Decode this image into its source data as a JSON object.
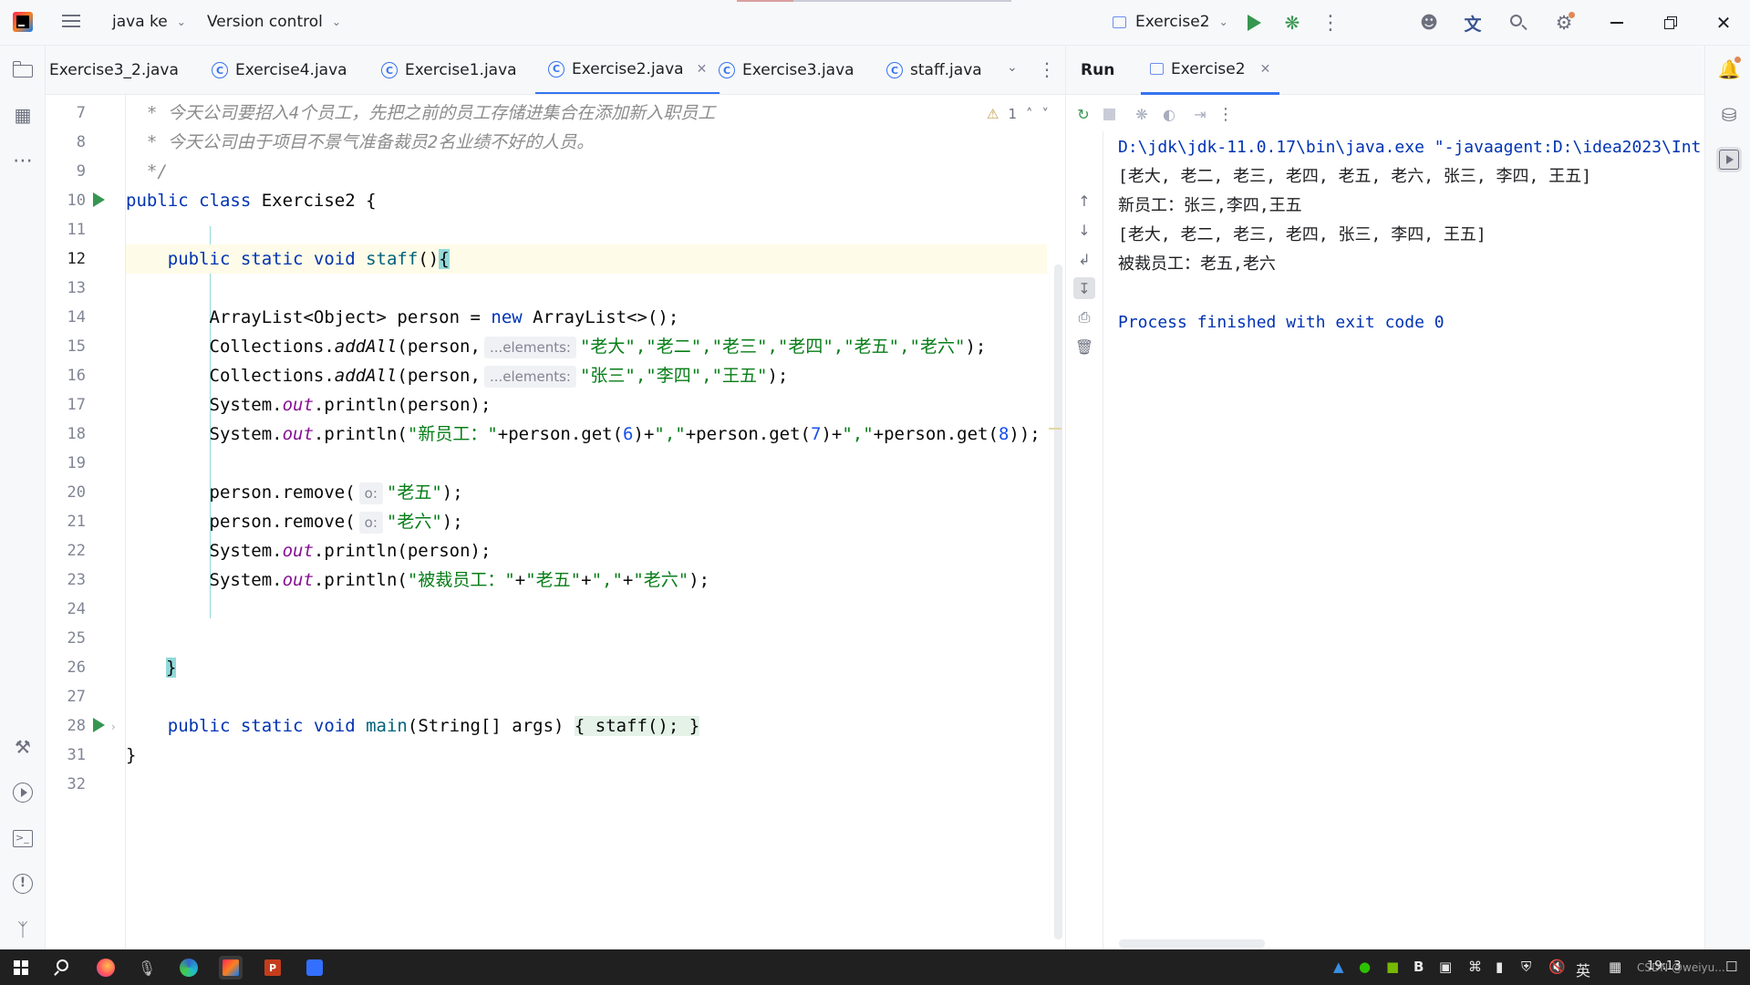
{
  "titlebar": {
    "project_label": "java ke",
    "vcs_label": "Version control",
    "run_config_label": "Exercise2"
  },
  "editor_tabs": [
    {
      "label": "Exercise3_2.java",
      "active": false
    },
    {
      "label": "Exercise4.java",
      "active": false
    },
    {
      "label": "Exercise1.java",
      "active": false
    },
    {
      "label": "Exercise2.java",
      "active": true
    },
    {
      "label": "Exercise3.java",
      "active": false
    },
    {
      "label": "staff.java",
      "active": false
    }
  ],
  "editor": {
    "warning_count": "1",
    "line_numbers": [
      "7",
      "8",
      "9",
      "10",
      "11",
      "12",
      "13",
      "14",
      "15",
      "16",
      "17",
      "18",
      "19",
      "20",
      "21",
      "22",
      "23",
      "24",
      "25",
      "26",
      "27",
      "28",
      "31",
      "32"
    ],
    "inlay_elements": "...elements:",
    "inlay_o": "o:",
    "lines": {
      "l7": "  * 今天公司要招入4个员工，先把之前的员工存储进集合在添加新入职员工",
      "l8": "  * 今天公司由于项目不景气准备裁员2名业绩不好的人员。",
      "l9": "  */",
      "l10_kw": "public class ",
      "l10_rest": "Exercise2 {",
      "l12_kw": "    public static void ",
      "l12_fn": "staff",
      "l12_paren": "()",
      "l12_brace": "{",
      "l14_a": "        ArrayList<Object> person = ",
      "l14_kw": "new",
      "l14_b": " ArrayList<>();",
      "l15_a": "        Collections.",
      "l15_m": "addAll",
      "l15_b": "(person,",
      "l15_str": "\"老大\",\"老二\",\"老三\",\"老四\",\"老五\",\"老六\"",
      "l15_end": ");",
      "l16_a": "        Collections.",
      "l16_m": "addAll",
      "l16_b": "(person,",
      "l16_str": "\"张三\",\"李四\",\"王五\"",
      "l16_end": ");",
      "l17_a": "        System.",
      "l17_f": "out",
      "l17_b": ".println(person);",
      "l18_a": "        System.",
      "l18_f": "out",
      "l18_b": ".println(",
      "l18_s1": "\"新员工：\"",
      "l18_c1": "+person.get(",
      "l18_n1": "6",
      "l18_c2": ")+",
      "l18_s2": "\",\"",
      "l18_c3": "+person.get(",
      "l18_n2": "7",
      "l18_c4": ")+",
      "l18_s3": "\",\"",
      "l18_c5": "+person.get(",
      "l18_n3": "8",
      "l18_c6": "));",
      "l20_a": "        person.remove(",
      "l20_str": "\"老五\"",
      "l20_end": ");",
      "l21_a": "        person.remove(",
      "l21_str": "\"老六\"",
      "l21_end": ");",
      "l22_a": "        System.",
      "l22_f": "out",
      "l22_b": ".println(person);",
      "l23_a": "        System.",
      "l23_f": "out",
      "l23_b": ".println(",
      "l23_s1": "\"被裁员工：\"",
      "l23_c1": "+",
      "l23_s2": "\"老五\"",
      "l23_c2": "+",
      "l23_s3": "\",\"",
      "l23_c3": "+",
      "l23_s4": "\"老六\"",
      "l23_end": ");",
      "l26": "}",
      "l28_kw": "    public static void ",
      "l28_fn": "main",
      "l28_b": "(String[] args) ",
      "l28_fold": "{ staff(); }",
      "l31": "}"
    }
  },
  "run_panel": {
    "title": "Run",
    "tab_label": "Exercise2",
    "console": [
      "D:\\jdk\\jdk-11.0.17\\bin\\java.exe \"-javaagent:D:\\idea2023\\Int",
      "[老大, 老二, 老三, 老四, 老五, 老六, 张三, 李四, 王五]",
      "新员工：张三,李四,王五",
      "[老大, 老二, 老三, 老四, 张三, 李四, 王五]",
      "被裁员工：老五,老六",
      "",
      "Process finished with exit code 0"
    ]
  },
  "taskbar": {
    "time": "19:13",
    "ime_label": "英",
    "watermark": "CSDN @weiyu..."
  },
  "colors": {
    "accent": "#3574f0",
    "keyword": "#0033b3",
    "string": "#067d17",
    "comment": "#8c8c8c",
    "run_green": "#369650"
  }
}
